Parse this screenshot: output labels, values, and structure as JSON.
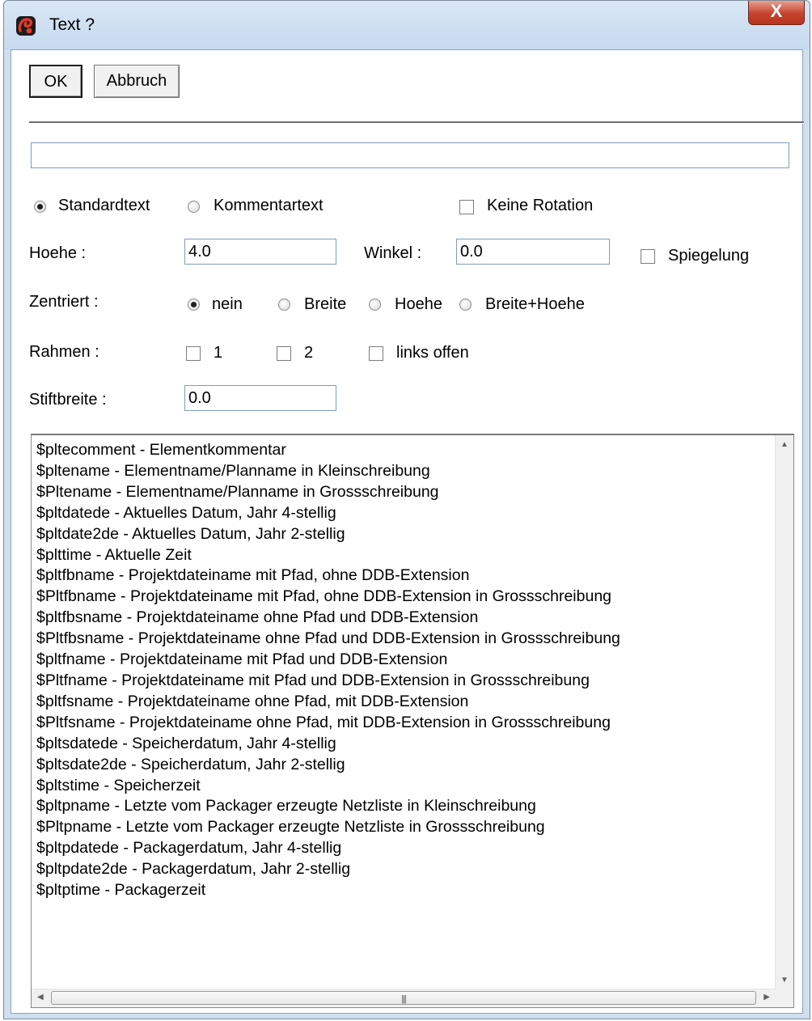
{
  "window": {
    "title": "Text ?",
    "close_label": "X"
  },
  "toolbar": {
    "ok_label": "OK",
    "cancel_label": "Abbruch"
  },
  "main_input": {
    "value": ""
  },
  "text_type": {
    "standard_label": "Standardtext",
    "comment_label": "Kommentartext",
    "selected": "standard"
  },
  "no_rotation": {
    "label": "Keine Rotation",
    "checked": false
  },
  "height": {
    "label": "Hoehe :",
    "value": "4.0"
  },
  "angle": {
    "label": "Winkel :",
    "value": "0.0"
  },
  "mirror": {
    "label": "Spiegelung",
    "checked": false
  },
  "centered": {
    "label": "Zentriert :",
    "options": [
      "nein",
      "Breite",
      "Hoehe",
      "Breite+Hoehe"
    ],
    "selected": "nein"
  },
  "frame": {
    "label": "Rahmen :",
    "options": [
      "1",
      "2",
      "links offen"
    ]
  },
  "pen_width": {
    "label": "Stiftbreite :",
    "value": "0.0"
  },
  "variables": [
    "$pltecomment - Elementkommentar",
    "$pltename - Elementname/Planname in Kleinschreibung",
    "$Pltename - Elementname/Planname in Grossschreibung",
    "$pltdatede - Aktuelles Datum, Jahr 4-stellig",
    "$pltdate2de - Aktuelles Datum, Jahr 2-stellig",
    "$plttime - Aktuelle Zeit",
    "$pltfbname - Projektdateiname mit Pfad, ohne DDB-Extension",
    "$Pltfbname - Projektdateiname mit Pfad, ohne DDB-Extension in Grossschreibung",
    "$pltfbsname - Projektdateiname ohne Pfad und DDB-Extension",
    "$Pltfbsname - Projektdateiname ohne Pfad und DDB-Extension in Grossschreibung",
    "$pltfname - Projektdateiname mit Pfad und DDB-Extension",
    "$Pltfname - Projektdateiname mit Pfad und DDB-Extension in Grossschreibung",
    "$pltfsname - Projektdateiname ohne Pfad, mit DDB-Extension",
    "$Pltfsname - Projektdateiname ohne Pfad, mit DDB-Extension in Grossschreibung",
    "$pltsdatede - Speicherdatum, Jahr 4-stellig",
    "$pltsdate2de - Speicherdatum, Jahr 2-stellig",
    "$pltstime - Speicherzeit",
    "$pltpname - Letzte vom Packager erzeugte Netzliste in Kleinschreibung",
    "$Pltpname - Letzte vom Packager erzeugte Netzliste in Grossschreibung",
    "$pltpdatede - Packagerdatum, Jahr 4-stellig",
    "$pltpdate2de - Packagerdatum, Jahr 2-stellig",
    "$pltptime - Packagerzeit"
  ],
  "icons": {
    "app": "app-logo-icon",
    "close": "close-icon",
    "scroll_up": "scroll-up-arrow-icon",
    "scroll_down": "scroll-down-arrow-icon",
    "scroll_left": "scroll-left-arrow-icon",
    "scroll_right": "scroll-right-arrow-icon"
  },
  "colors": {
    "titlebar": "#c6d9ee",
    "close_button": "#c5432d",
    "accent_red": "#d42a1f"
  }
}
